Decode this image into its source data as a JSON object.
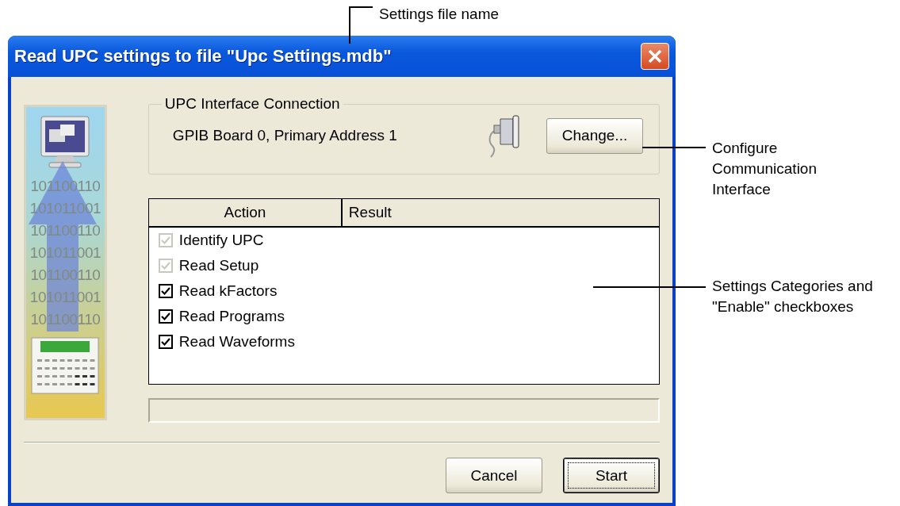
{
  "window": {
    "title": "Read UPC settings to file \"Upc Settings.mdb\""
  },
  "side_panel": {
    "binary_lines": [
      "101100110",
      "101011001",
      "101100110",
      "101011001",
      "101100110",
      "101011001",
      "101100110"
    ]
  },
  "connection": {
    "legend": "UPC Interface Connection",
    "description": "GPIB Board 0, Primary Address 1",
    "button": "Change..."
  },
  "table": {
    "columns": [
      "Action",
      "Result"
    ],
    "rows": [
      {
        "label": "Identify UPC",
        "checked": true,
        "disabled": true
      },
      {
        "label": "Read Setup",
        "checked": true,
        "disabled": true
      },
      {
        "label": "Read kFactors",
        "checked": true,
        "disabled": false
      },
      {
        "label": "Read Programs",
        "checked": true,
        "disabled": false
      },
      {
        "label": "Read Waveforms",
        "checked": true,
        "disabled": false
      }
    ]
  },
  "progress": {
    "level": 0
  },
  "buttons": [
    {
      "label": "Cancel",
      "default": false
    },
    {
      "label": "Start",
      "default": true
    }
  ],
  "annotations": [
    {
      "text": "Settings file name",
      "kind": "title"
    },
    {
      "text": "Configure Communication Interface",
      "kind": "change"
    },
    {
      "text": "Settings Categories and \"Enable\" checkboxes",
      "kind": "list"
    }
  ]
}
